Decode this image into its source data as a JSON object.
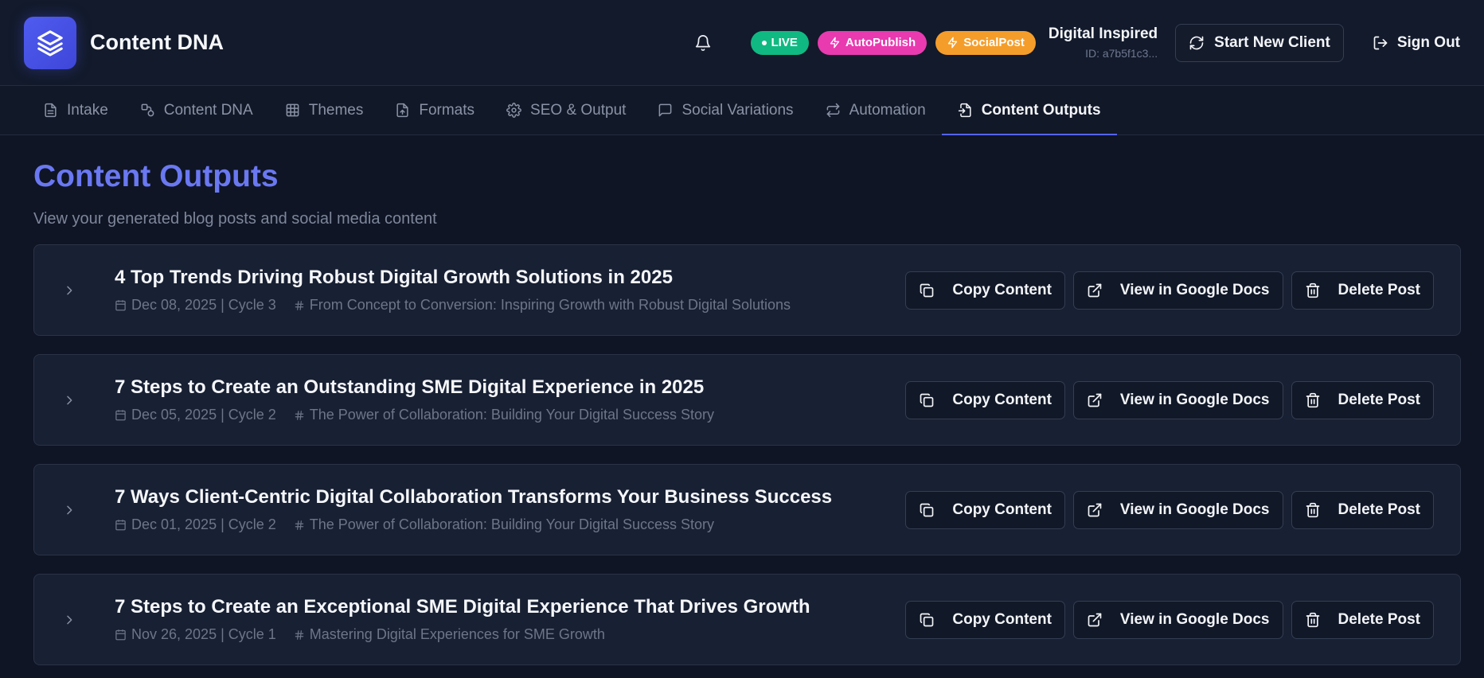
{
  "app": {
    "title": "Content DNA",
    "accent": "#5563f2"
  },
  "header": {
    "badges": {
      "live": "LIVE",
      "autopublish": "AutoPublish",
      "socialpost": "SocialPost"
    },
    "client": {
      "name": "Digital Inspired",
      "id": "ID: a7b5f1c3..."
    },
    "start_new_client": "Start New Client",
    "sign_out": "Sign Out"
  },
  "tabs": [
    {
      "label": "Intake",
      "icon": "document-icon"
    },
    {
      "label": "Content DNA",
      "icon": "shapes-icon"
    },
    {
      "label": "Themes",
      "icon": "grid-icon"
    },
    {
      "label": "Formats",
      "icon": "file-upload-icon"
    },
    {
      "label": "SEO & Output",
      "icon": "gear-icon"
    },
    {
      "label": "Social Variations",
      "icon": "chat-bubble-icon"
    },
    {
      "label": "Automation",
      "icon": "repeat-icon"
    },
    {
      "label": "Content Outputs",
      "icon": "file-export-icon",
      "active": true
    }
  ],
  "page": {
    "title": "Content Outputs",
    "subtitle": "View your generated blog posts and social media content"
  },
  "actions": {
    "copy": "Copy Content",
    "view": "View in Google Docs",
    "delete": "Delete Post"
  },
  "posts": [
    {
      "title": "4 Top Trends Driving Robust Digital Growth Solutions in 2025",
      "date_cycle": "Dec 08, 2025 | Cycle 3",
      "theme": "From Concept to Conversion: Inspiring Growth with Robust Digital Solutions"
    },
    {
      "title": "7 Steps to Create an Outstanding SME Digital Experience in 2025",
      "date_cycle": "Dec 05, 2025 | Cycle 2",
      "theme": "The Power of Collaboration: Building Your Digital Success Story"
    },
    {
      "title": "7 Ways Client-Centric Digital Collaboration Transforms Your Business Success",
      "date_cycle": "Dec 01, 2025 | Cycle 2",
      "theme": "The Power of Collaboration: Building Your Digital Success Story"
    },
    {
      "title": "7 Steps to Create an Exceptional SME Digital Experience That Drives Growth",
      "date_cycle": "Nov 26, 2025 | Cycle 1",
      "theme": "Mastering Digital Experiences for SME Growth"
    }
  ]
}
